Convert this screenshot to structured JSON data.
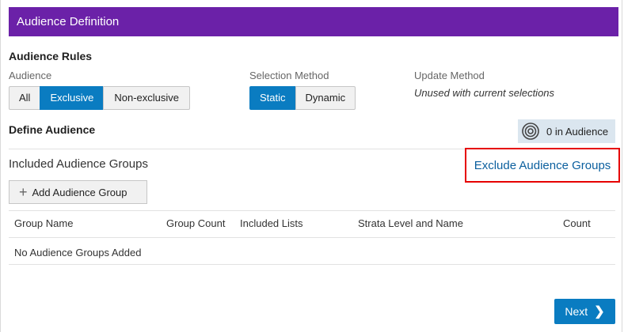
{
  "header": {
    "title": "Audience Definition"
  },
  "rules": {
    "title": "Audience Rules",
    "audience": {
      "label": "Audience",
      "options": [
        "All",
        "Exclusive",
        "Non-exclusive"
      ],
      "selected": "Exclusive"
    },
    "selection_method": {
      "label": "Selection Method",
      "options": [
        "Static",
        "Dynamic"
      ],
      "selected": "Static"
    },
    "update_method": {
      "label": "Update Method",
      "value": "Unused with current selections"
    }
  },
  "define": {
    "title": "Define Audience",
    "count_badge": "0 in Audience"
  },
  "groups": {
    "included_label": "Included Audience Groups",
    "exclude_link": "Exclude Audience Groups",
    "add_button": "Add Audience Group",
    "columns": [
      "Group Name",
      "Group Count",
      "Included Lists",
      "Strata Level and Name",
      "Count"
    ],
    "empty_message": "No Audience Groups Added"
  },
  "footer": {
    "next_label": "Next"
  },
  "colors": {
    "header_bg": "#6b21a8",
    "accent": "#0a7cc1",
    "highlight_border": "#e60000"
  }
}
